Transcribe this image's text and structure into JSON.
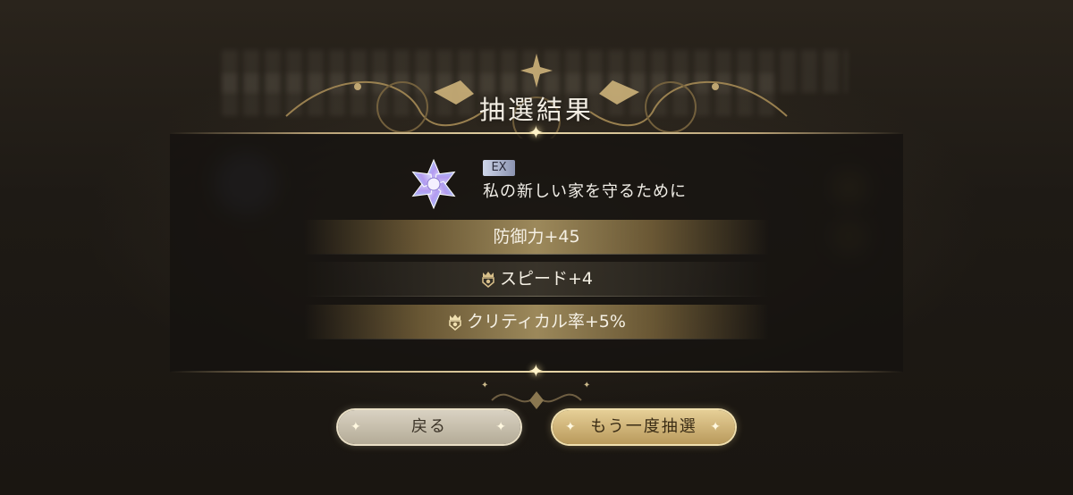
{
  "dialog": {
    "title": "抽選結果"
  },
  "skill": {
    "rank_badge": "EX",
    "name": "私の新しい家を守るために",
    "icon": "crystal-flower-icon"
  },
  "results": [
    {
      "text": "防御力+45",
      "has_crown": false
    },
    {
      "text": "スピード+4",
      "has_crown": true
    },
    {
      "text": "クリティカル率+5%",
      "has_crown": true
    }
  ],
  "buttons": {
    "back_label": "戻る",
    "retry_label": "もう一度抽選"
  },
  "colors": {
    "gold_accent": "#e8d7a9",
    "gold_button": "#d4b97a",
    "silver_button": "#c9c1ad"
  }
}
